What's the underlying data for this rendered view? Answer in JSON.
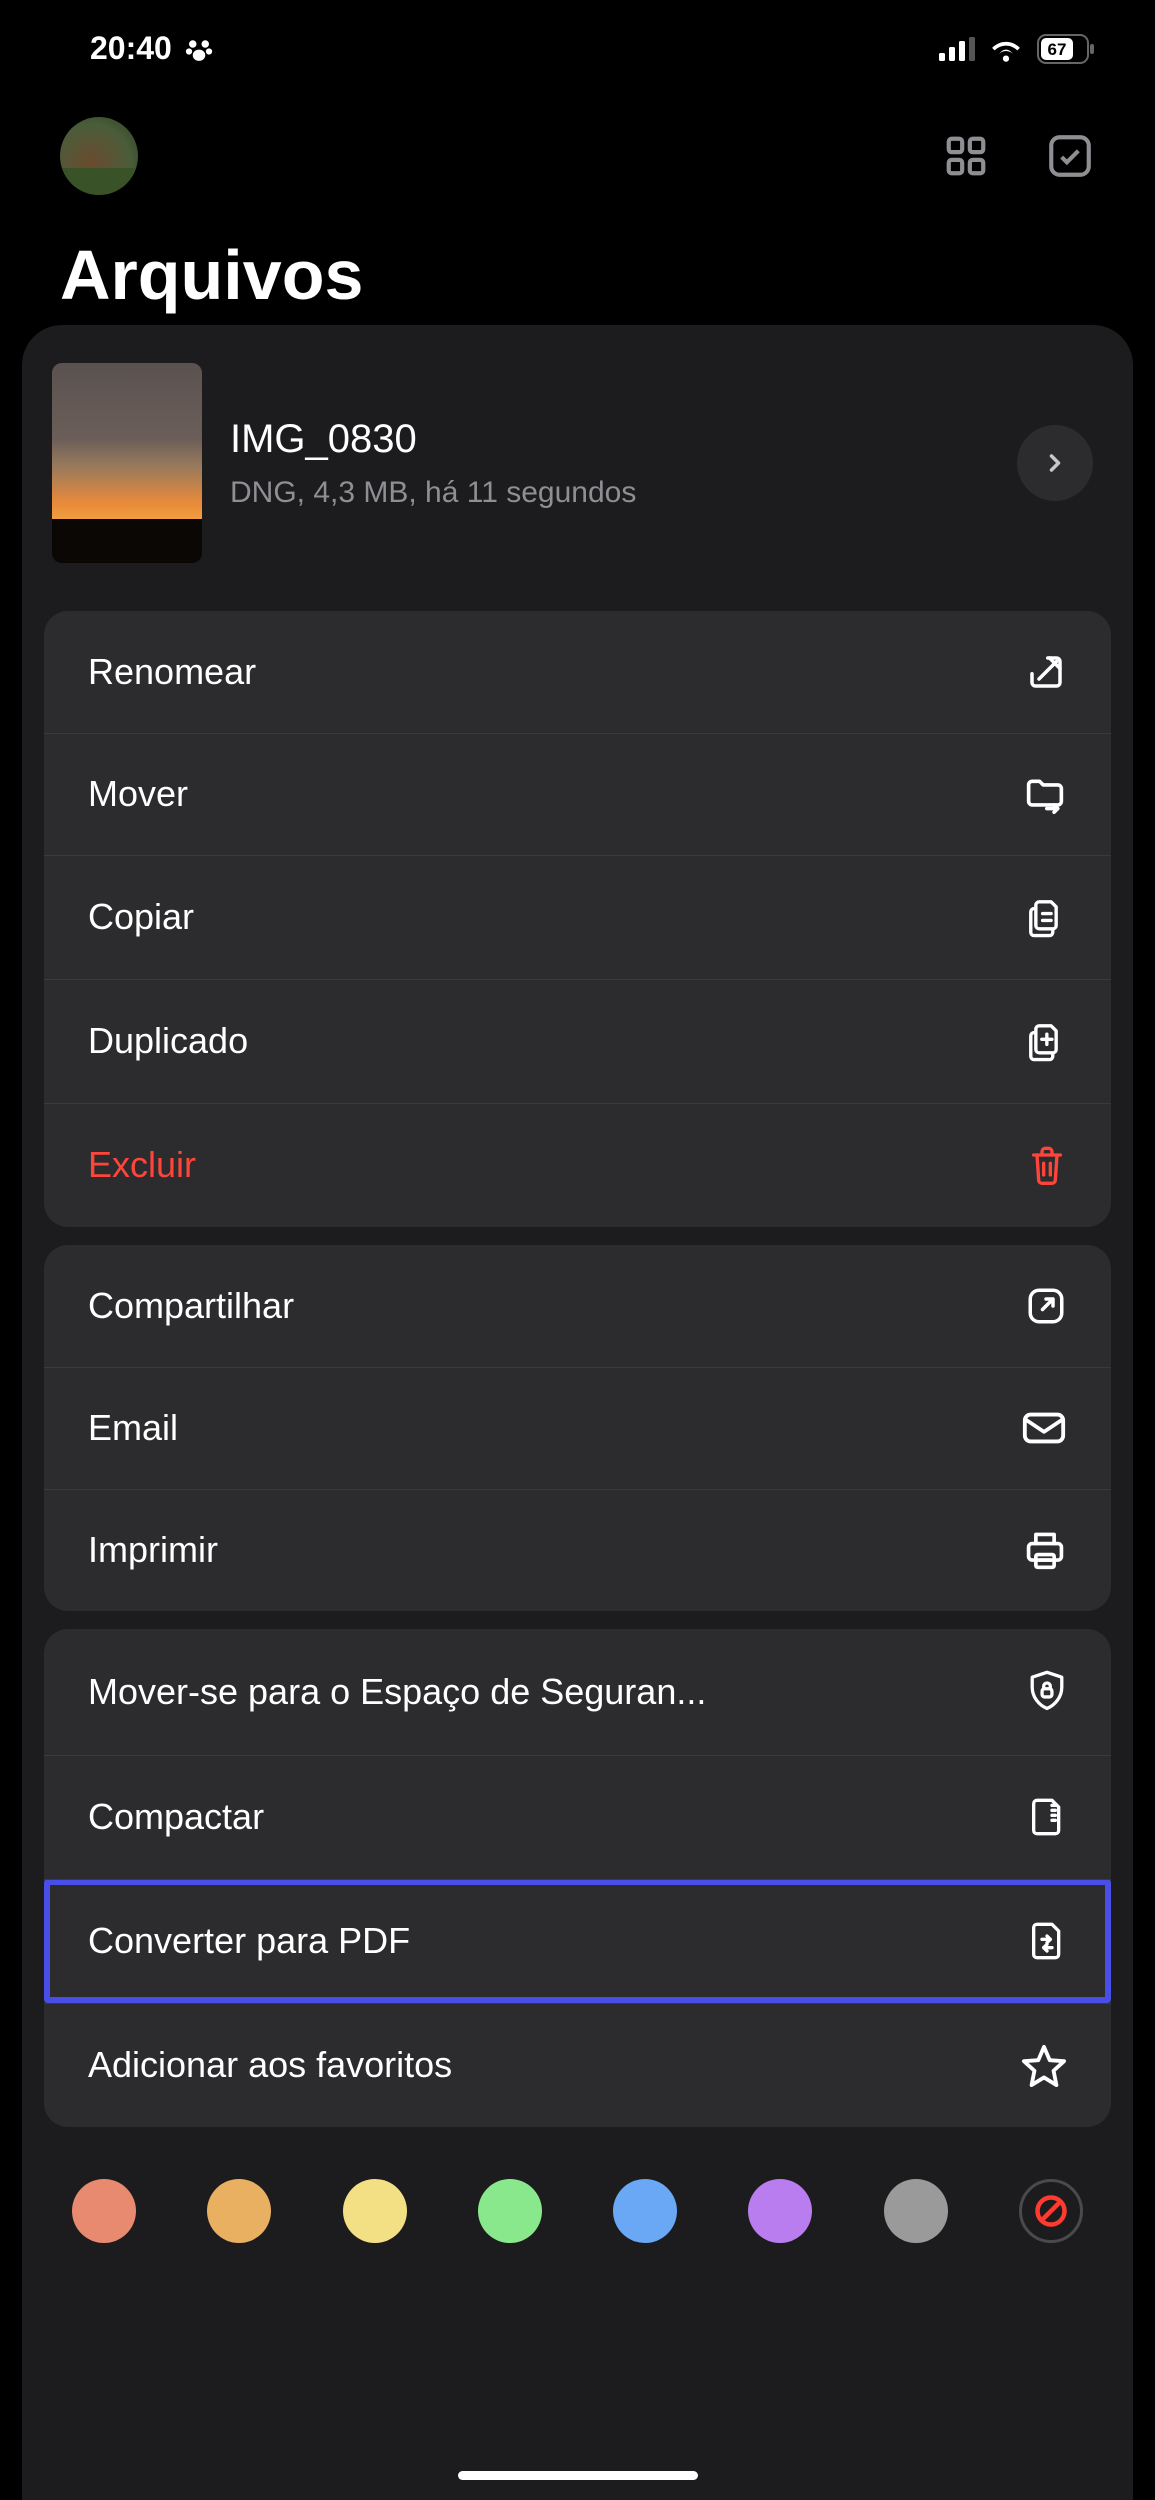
{
  "status": {
    "time": "20:40",
    "paw_icon": "paw-icon",
    "battery": "67"
  },
  "page": {
    "title": "Arquivos"
  },
  "file": {
    "name": "IMG_0830",
    "meta": "DNG, 4,3 MB, há 11 segundos"
  },
  "groups": [
    {
      "items": [
        {
          "label": "Renomear",
          "icon": "edit-icon",
          "danger": false
        },
        {
          "label": "Mover",
          "icon": "folder-move-icon",
          "danger": false
        },
        {
          "label": "Copiar",
          "icon": "copy-file-icon",
          "danger": false
        },
        {
          "label": "Duplicado",
          "icon": "duplicate-icon",
          "danger": false
        },
        {
          "label": "Excluir",
          "icon": "trash-icon",
          "danger": true
        }
      ]
    },
    {
      "items": [
        {
          "label": "Compartilhar",
          "icon": "share-icon",
          "danger": false
        },
        {
          "label": "Email",
          "icon": "mail-icon",
          "danger": false
        },
        {
          "label": "Imprimir",
          "icon": "print-icon",
          "danger": false
        }
      ]
    },
    {
      "items": [
        {
          "label": "Mover-se para o Espaço de Seguran...",
          "icon": "lock-shield-icon",
          "danger": false
        },
        {
          "label": "Compactar",
          "icon": "zip-icon",
          "danger": false
        },
        {
          "label": "Converter para PDF",
          "icon": "convert-pdf-icon",
          "danger": false,
          "highlighted": true
        },
        {
          "label": "Adicionar aos favoritos",
          "icon": "star-icon",
          "danger": false
        }
      ]
    }
  ],
  "tags": {
    "colors": [
      "#e88a70",
      "#e8b060",
      "#f3e085",
      "#8ae88c",
      "#6aa8f5",
      "#b97df0",
      "#9a9a9a"
    ]
  }
}
